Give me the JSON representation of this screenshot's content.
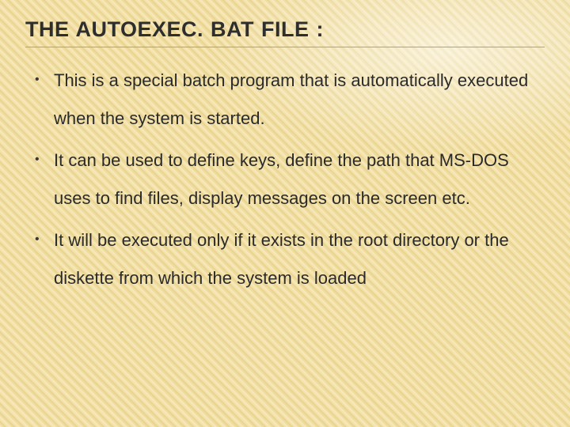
{
  "slide": {
    "title": "THE AUTOEXEC. BAT FILE :",
    "bullets": [
      "This is a special batch program that is automatically executed when the system is started.",
      "It can be used to define keys, define the path that MS-DOS uses to find files, display messages on the screen etc.",
      "It will be executed only if it exists in the root directory or the diskette from which the system is loaded"
    ]
  }
}
